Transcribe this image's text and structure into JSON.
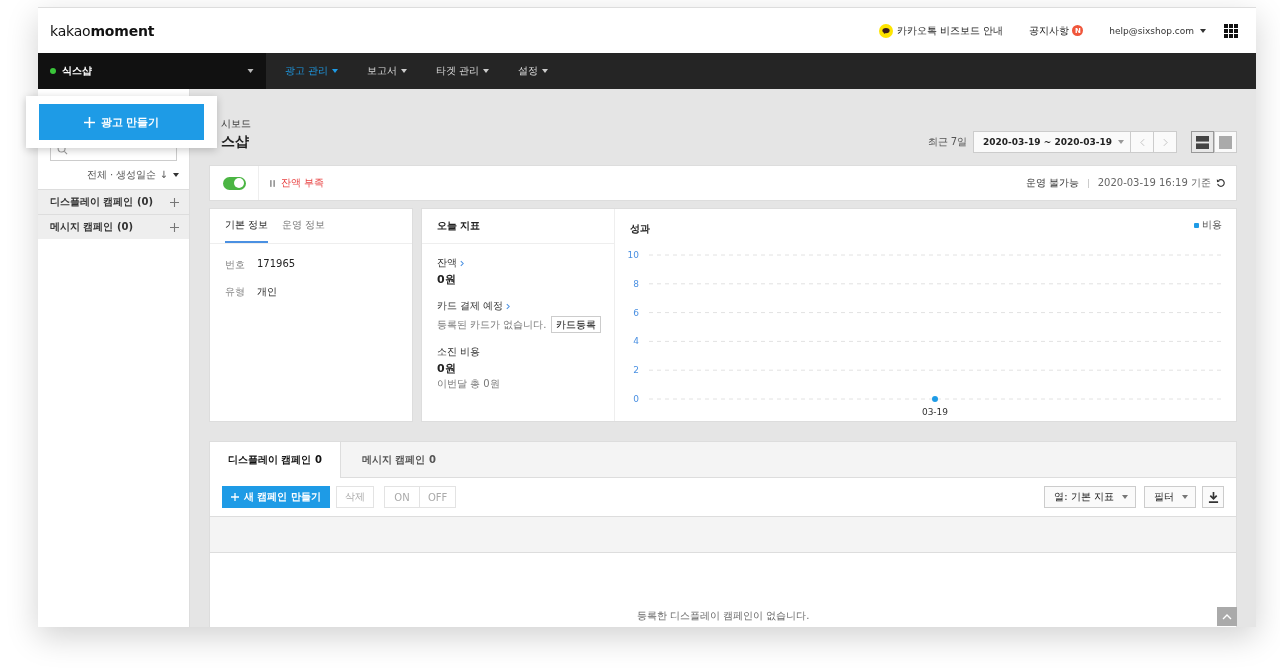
{
  "header": {
    "logo": "kakao**moment**",
    "guide_link": "카카오톡 비즈보드 안내",
    "notice_link": "공지사항",
    "notice_badge": "N",
    "account": "help@sixshop.com"
  },
  "nav": {
    "account_name": "식스샵",
    "account_active": true,
    "menus": [
      {
        "label": "광고 관리",
        "selected": true
      },
      {
        "label": "보고서",
        "selected": false
      },
      {
        "label": "타겟 관리",
        "selected": false
      },
      {
        "label": "설정",
        "selected": false
      }
    ]
  },
  "create_ad_button": "광고 만들기",
  "sidebar": {
    "sort": "전체 · 생성일순 ↓",
    "groups": [
      {
        "label": "디스플레이 캠페인 (0)"
      },
      {
        "label": "메시지 캠페인 (0)"
      }
    ]
  },
  "page": {
    "breadcrumb": "시보드",
    "title": "스샵",
    "period_label": "최근 7일",
    "date_range": "2020-03-19 ~ 2020-03-19",
    "view_modes": [
      {
        "kind": "rows",
        "selected": true
      },
      {
        "kind": "single",
        "selected": false
      }
    ]
  },
  "status": {
    "on": true,
    "state": "잔액 부족",
    "operation": "운영 불가능",
    "timestamp": "2020-03-19 16:19 기준"
  },
  "info_card": {
    "tabs": [
      {
        "label": "기본 정보",
        "selected": true
      },
      {
        "label": "운영 정보",
        "selected": false
      }
    ],
    "fields": [
      {
        "label": "번호",
        "value": "171965"
      },
      {
        "label": "유형",
        "value": "개인"
      }
    ]
  },
  "today": {
    "title": "오늘 지표",
    "balance_label": "잔액",
    "balance": "0원",
    "card_label": "카드 결제 예정",
    "card_note": "등록된 카드가 없습니다.",
    "card_button": "카드등록",
    "spend_label": "소진 비용",
    "spend": "0원",
    "spend_note": "이번달 총 0원"
  },
  "performance": {
    "title": "성과",
    "chart_data": {
      "type": "line",
      "x": [
        "03-19"
      ],
      "series": [
        {
          "name": "비용",
          "color": "#1e9be6",
          "values": [
            0
          ],
          "marker": "circle"
        }
      ],
      "ylim": [
        0,
        10
      ],
      "yticks": [
        0,
        2,
        4,
        6,
        8,
        10
      ],
      "grid": true
    }
  },
  "campaigns": {
    "tabs": [
      {
        "label": "디스플레이 캠페인 0",
        "selected": true
      },
      {
        "label": "메시지 캠페인 0",
        "selected": false
      }
    ],
    "new_button": "새 캠페인 만들기",
    "delete_button": "삭제",
    "on_button": "ON",
    "off_button": "OFF",
    "column_select": "열: 기본 지표",
    "filter": "필터",
    "empty_message": "등록한 디스플레이 캠페인이 없습니다."
  }
}
